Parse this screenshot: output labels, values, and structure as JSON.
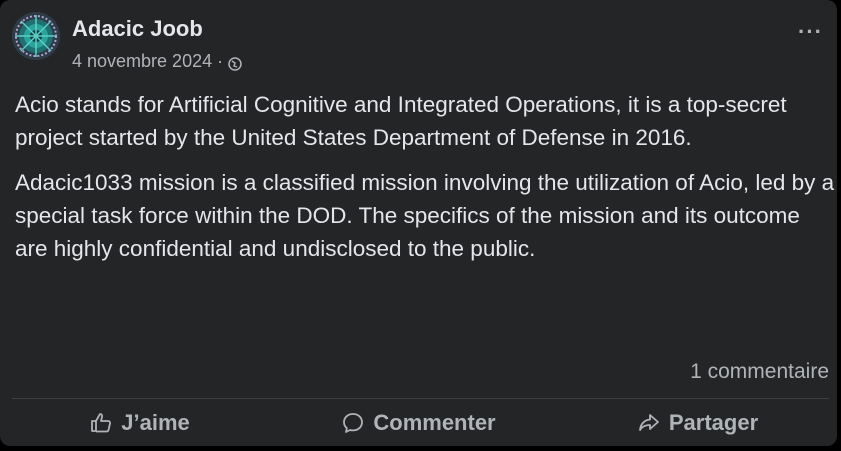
{
  "post": {
    "author": "Adacic Joob",
    "date": "4 novembre 2024",
    "separator": "·",
    "privacy_icon": "globe-icon",
    "more_icon": "more-options-icon",
    "more_label": "···",
    "paragraphs": [
      "Acio stands for Artificial Cognitive and Integrated Operations, it is a top-secret project started by the United States Department of Defense in 2016.",
      "Adacic1033 mission is a classified mission involving the utilization of Acio, led by a special task force within the DOD. The specifics of the mission and its outcome are highly confidential and undisclosed to the public."
    ],
    "comments_count": "1 commentaire"
  },
  "actions": {
    "like_label": "J’aime",
    "comment_label": "Commenter",
    "share_label": "Partager",
    "like_icon": "thumbs-up-icon",
    "comment_icon": "speech-bubble-icon",
    "share_icon": "share-arrow-icon"
  },
  "colors": {
    "background": "#242526",
    "primary_text": "#e4e6eb",
    "secondary_text": "#b0b3b8",
    "divider": "#3e4042"
  }
}
